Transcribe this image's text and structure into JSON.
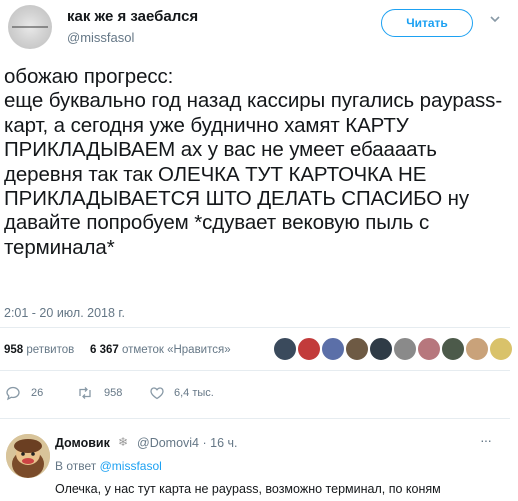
{
  "header": {
    "display_name": "как же я заебался",
    "screen_name": "@missfasol",
    "follow_label": "Читать"
  },
  "tweet": {
    "text": "обожаю прогресс:\nеще буквально год назад кассиры пугались paypass-карт, а сегодня уже буднично хамят КАРТУ ПРИКЛАДЫВАЕМ ах у вас не умеет ебаааать деревня так так ОЛЕЧКА ТУТ КАРТОЧКА НЕ ПРИКЛАДЫВАЕТСЯ ШТО ДЕЛАТЬ СПАСИБО ну давайте попробуем *сдувает вековую пыль с терминала*",
    "timestamp": "2:01 - 20 июл. 2018 г."
  },
  "stats": {
    "retweets_count": "958",
    "retweets_label": "ретвитов",
    "likes_count": "6 367",
    "likes_label": "отметок «Нравится»"
  },
  "actions": {
    "reply_count": "26",
    "retweet_count": "958",
    "like_count": "6,4 тыс."
  },
  "reply": {
    "name": "Домовик",
    "snowflake": "❄",
    "handle_time": "@Domovi4 · 16 ч.",
    "in_reply_prefix": "В ответ",
    "in_reply_mention": "@missfasol",
    "text": "Олечка, у нас тут карта не paypass, возможно терминал, по коням"
  },
  "colors": {
    "accent": "#1da1f2",
    "muted": "#657786",
    "text": "#14171a"
  },
  "icons": [
    "caret-down-icon",
    "reply-icon",
    "retweet-icon",
    "heart-icon",
    "snowflake-icon"
  ]
}
